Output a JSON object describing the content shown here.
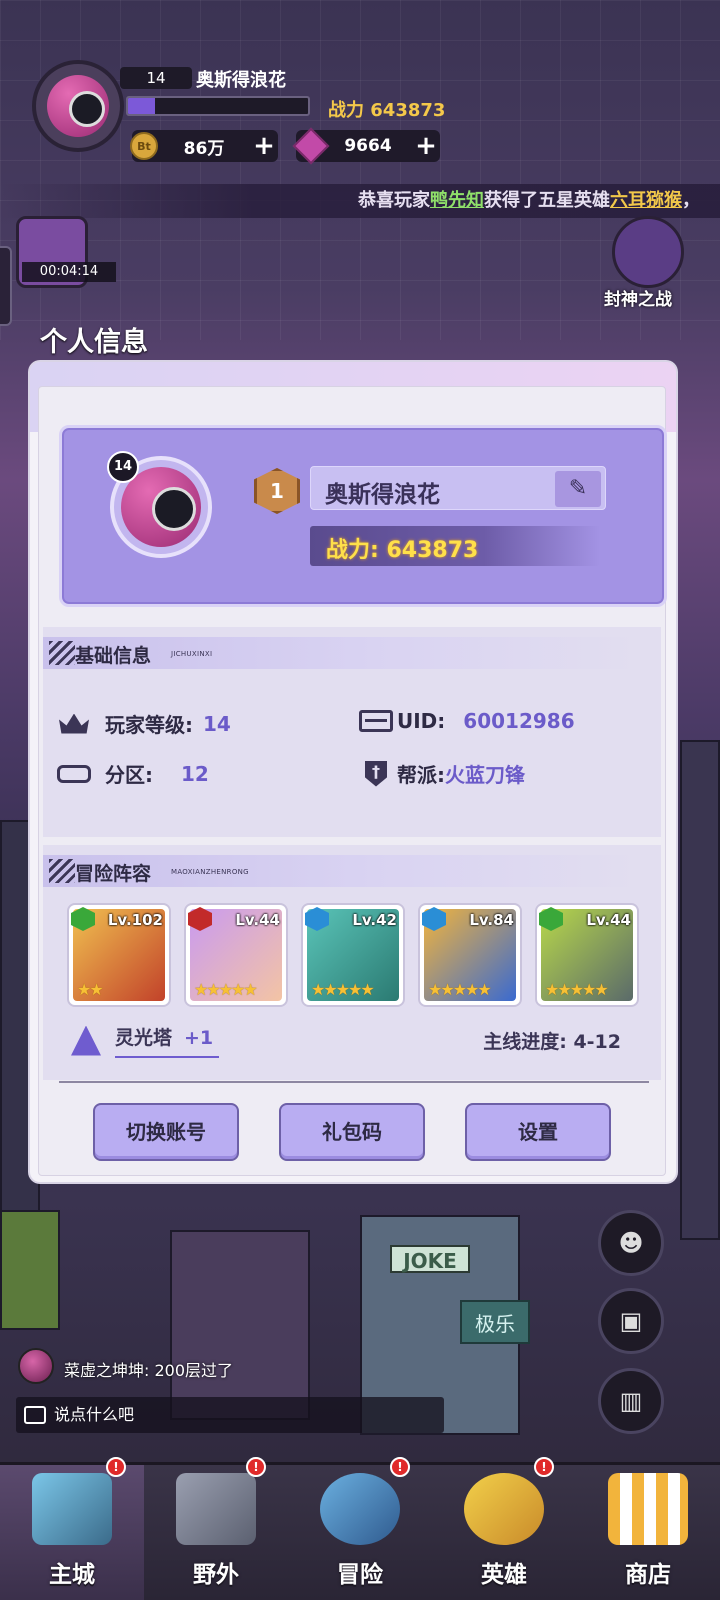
{
  "hud": {
    "level": "14",
    "player_name": "奥斯得浪花",
    "power_text": "战力 643873",
    "xp_fraction": 0.15,
    "gold_icon_text": "Bt",
    "gold": "86万",
    "gems": "9664",
    "plus": "+"
  },
  "marquee": {
    "prefix": "恭喜玩家",
    "player": "鸭先知",
    "middle": "获得了五星英雄",
    "hero": "六耳猕猴",
    "suffix": "，"
  },
  "side": {
    "timer": "00:04:14",
    "event_label": "封神之战"
  },
  "modal": {
    "title": "个人信息",
    "avatar_level": "14",
    "rank": "1",
    "name": "奥斯得浪花",
    "edit_icon": "✎",
    "power": "战力: 643873",
    "basic_section": {
      "title": "基础信息",
      "subtitle": "JICHUXINXI",
      "player_level_label": "玩家等级:",
      "player_level": "14",
      "uid_label": "UID:",
      "uid": "60012986",
      "server_label": "分区:",
      "server": "12",
      "guild_label": "帮派:",
      "guild": "火蓝刀锋"
    },
    "lineup_section": {
      "title": "冒险阵容",
      "subtitle": "MAOXIANZHENRONG",
      "heroes": [
        {
          "level": "Lv.102",
          "element_color": "#3aa83a",
          "stars": "★★"
        },
        {
          "level": "Lv.44",
          "element_color": "#c22a2a",
          "stars": "★★★★★"
        },
        {
          "level": "Lv.42",
          "element_color": "#2a8ed6",
          "stars": "★★★★★"
        },
        {
          "level": "Lv.84",
          "element_color": "#2a8ed6",
          "stars": "★★★★★"
        },
        {
          "level": "Lv.44",
          "element_color": "#3aa83a",
          "stars": "★★★★★"
        }
      ],
      "tower_label": "灵光塔",
      "tower_value": "+1",
      "progress_label": "主线进度: 4-12"
    },
    "buttons": {
      "switch_account": "切换账号",
      "gift_code": "礼包码",
      "settings": "设置"
    }
  },
  "bg_signs": {
    "joke": "JOKE",
    "jile": "极乐"
  },
  "chat": {
    "recent_message": "菜虚之坤坤: 200层过了",
    "input_placeholder": "说点什么吧"
  },
  "bottom_nav": [
    {
      "label": "主城",
      "badge": "!"
    },
    {
      "label": "野外",
      "badge": "!"
    },
    {
      "label": "冒险",
      "badge": "!"
    },
    {
      "label": "英雄",
      "badge": "!"
    },
    {
      "label": "商店",
      "badge": ""
    }
  ]
}
